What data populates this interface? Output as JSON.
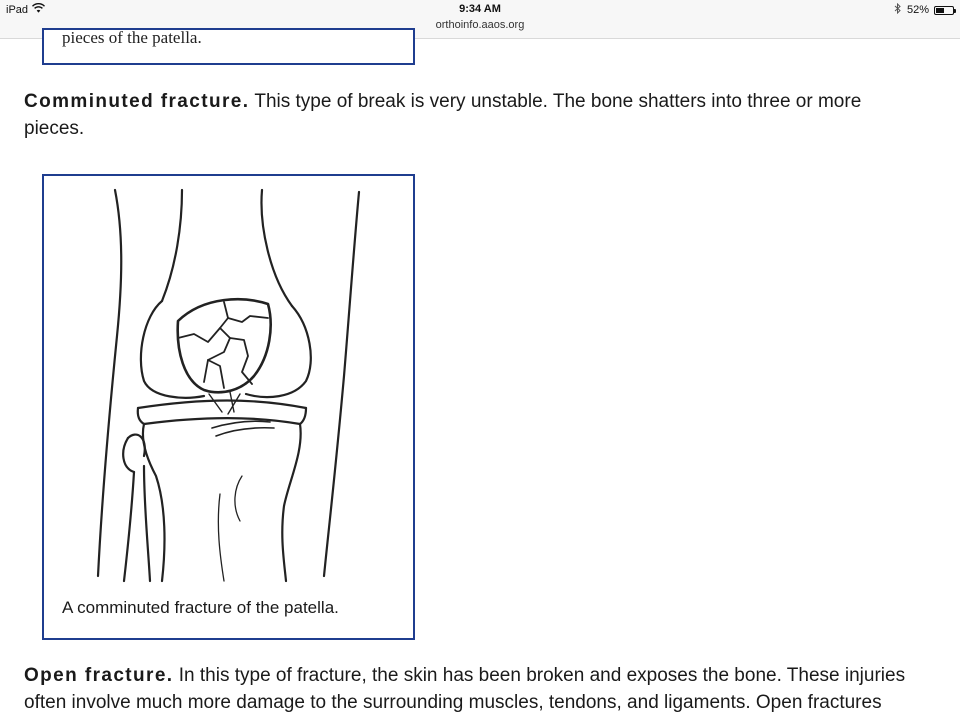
{
  "status_bar": {
    "device": "iPad",
    "time": "9:34 AM",
    "url": "orthoinfo.aaos.org",
    "battery_percent_label": "52%",
    "battery_level": 0.52,
    "icons": [
      "wifi-icon",
      "bluetooth-icon",
      "battery-icon"
    ]
  },
  "article": {
    "previous_figure_caption": "pieces of the patella.",
    "comminuted": {
      "term": "Comminuted fracture.",
      "line1": " This type of break is very unstable. The bone shatters into three or more",
      "line2": "pieces."
    },
    "figure": {
      "caption": "A comminuted fracture of the patella.",
      "illustration": "knee-illustration"
    },
    "open": {
      "term": "Open fracture.",
      "line1": " In this type of fracture, the skin has been broken and exposes the bone. These injuries",
      "line2": "often involve much more damage to the surrounding muscles, tendons, and ligaments. Open fractures"
    }
  },
  "colors": {
    "figure_border": "#1f3d8f",
    "text": "#1a1a1a"
  }
}
